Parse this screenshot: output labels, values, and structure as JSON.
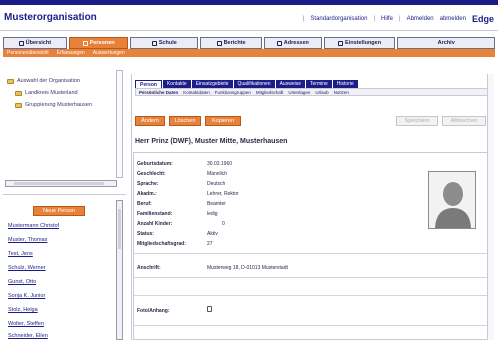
{
  "app": {
    "title": "Musterorganisation"
  },
  "top_links": {
    "link1": "Standardorganisation",
    "link2": "Hilfe",
    "link3": "Abmelden",
    "link4": "abmelden",
    "logo": "Edge"
  },
  "nav": {
    "tabs": [
      {
        "label": "Übersicht",
        "icon": "home-icon"
      },
      {
        "label": "Personen",
        "icon": "person-icon"
      },
      {
        "label": "Schule",
        "icon": "school-icon"
      },
      {
        "label": "Berichte",
        "icon": "report-icon"
      },
      {
        "label": "Adressen",
        "icon": "address-icon"
      },
      {
        "label": "Einstellungen",
        "icon": "settings-icon"
      },
      {
        "label": "Archiv",
        "icon": "archive-icon"
      }
    ],
    "active_tab": "Personen"
  },
  "subnav": {
    "items": [
      "Personenübersicht",
      "Erfassungen",
      "Auswertungen"
    ]
  },
  "sidebar": {
    "tree": [
      {
        "label": "Auswahl der Organisation"
      },
      {
        "label": "Landkreis Musterland"
      },
      {
        "label": "Gruppierung Musterhausen"
      }
    ],
    "new_person_button": "Neue Person",
    "persons": [
      "Mustermann Christof",
      "Muster, Thomas",
      "Test, Jens",
      "Schulz, Werner",
      "Gunst, Otto",
      "Sonja K. Junior",
      "Stolz, Helga",
      "Wolter, Steffen",
      "Schneider, Ellen"
    ]
  },
  "main": {
    "tabs": [
      "Person",
      "Kontakte",
      "Einsatzgebiete",
      "Qualifikationen",
      "Ausweise",
      "Termine",
      "Historie"
    ],
    "active_tab": "Person",
    "tab_strip": [
      "Persönliche Daten",
      "Kontaktdaten",
      "Funktionsgruppen",
      "Mitgliedschaft",
      "Unterlagen",
      "Urlaub",
      "Notizen"
    ],
    "buttons": {
      "edit": "Ändern",
      "delete": "Löschen",
      "new": "Kopieren",
      "save": "Speichern",
      "cancel": "Abbrechen"
    },
    "person_title": "Herr Prinz (DWF), Muster Mitte, Musterhausen",
    "fields": [
      {
        "label": "Geburtsdatum:",
        "value": "30.03.1960"
      },
      {
        "label": "Geschlecht:",
        "value": "Männlich"
      },
      {
        "label": "Sprache:",
        "value": "Deutsch"
      },
      {
        "label": "Akadm.:",
        "value": "Lehrer, Rektor"
      },
      {
        "label": "Beruf:",
        "value": "Beamter"
      },
      {
        "label": "Familienstand:",
        "value": "ledig"
      },
      {
        "label": "Anzahl Kinder:",
        "value": "0"
      },
      {
        "label": "Status:",
        "value": "Aktiv"
      },
      {
        "label": "Mitgliedschaftsgrad:",
        "value": "27"
      }
    ],
    "extra": {
      "label": "Anschrift:",
      "value": "Musterweg 18, D-01013 Musterstadt"
    },
    "attachment_label": "Foto/Anhang:"
  }
}
